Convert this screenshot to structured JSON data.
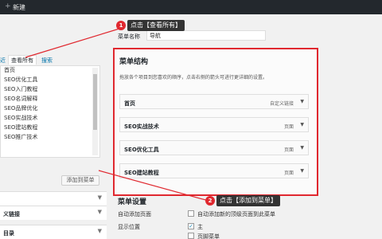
{
  "topbar": {
    "plus_icon": "plus-icon",
    "new_label": "新建"
  },
  "left": {
    "tabs": [
      {
        "label": "近"
      },
      {
        "label": "查看所有"
      },
      {
        "label": "搜索"
      }
    ],
    "items": [
      "首页",
      "SEO优化工具",
      "SEO入门教程",
      "SEO名词解释",
      "SEO品牌优化",
      "SEO实战技术",
      "SEO建站教程",
      "SEO推广技术"
    ],
    "add_button": "添加到菜单",
    "accordions": [
      {
        "label": ""
      },
      {
        "label": "义链接"
      },
      {
        "label": "目录"
      }
    ]
  },
  "main": {
    "name_label": "菜单名称",
    "name_value": "导航",
    "structure_title": "菜单结构",
    "structure_desc": "拖放各个项目到您喜欢的顺序，点击右侧的箭头可进行更详细的设置。",
    "menu_items": [
      {
        "name": "首页",
        "type": "自定义链接"
      },
      {
        "name": "SEO实战技术",
        "type": "页面"
      },
      {
        "name": "SEO优化工具",
        "type": "页面"
      },
      {
        "name": "SEO建站教程",
        "type": "页面"
      }
    ],
    "settings_title": "菜单设置",
    "auto_add_label": "自动添加页面",
    "auto_add_text": "自动添加新的顶级页面到此菜单",
    "display_label": "显示位置",
    "location_1": "主",
    "location_2": "页脚菜单"
  },
  "callouts": [
    {
      "num": "1",
      "text": "点击【查看所有】"
    },
    {
      "num": "2",
      "text": "点击【添加到菜单】"
    }
  ],
  "colors": {
    "highlight": "#e0282f",
    "link": "#0073aa",
    "admin_bar": "#23282d"
  }
}
